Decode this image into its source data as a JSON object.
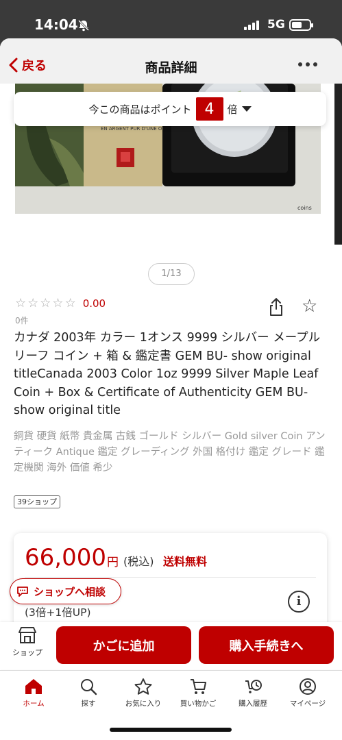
{
  "status_bar": {
    "time": "14:04",
    "network": "5G"
  },
  "navbar": {
    "back_label": "戻る",
    "title": "商品詳細"
  },
  "points_banner": {
    "prefix": "今この商品はポイント",
    "multiplier": "4",
    "suffix": "倍"
  },
  "image": {
    "pager": "1/13",
    "text_block": "EN ARGENT PUR D'UNE ONCE",
    "watermark": "coins"
  },
  "rating": {
    "score": "0.00",
    "stars_filled": 0,
    "review_count": "0件"
  },
  "product": {
    "title": "カナダ 2003年 カラー 1オンス 9999 シルバー メープルリーフ コイン + 箱 & 鑑定書 GEM BU- show original titleCanada 2003 Color 1oz 9999 Silver Maple Leaf Coin + Box & Certificate of Authenticity GEM BU- show original title",
    "tags": "銅貨 硬貨 紙幣 貴金属 古銭 ゴールド シルバー Gold silver Coin アンティーク Antique 鑑定 グレーディング 外国 格付け 鑑定 グレード 鑑定機関 海外 価値 希少",
    "shop_badge": "39ショップ"
  },
  "price": {
    "amount": "66,000",
    "currency": "円",
    "tax_label": "(税込)",
    "shipping": "送料無料",
    "points_up": "(3倍+1倍UP)"
  },
  "consult_button": "ショップへ相談",
  "actions": {
    "shop_label": "ショップ",
    "add_to_cart": "かごに追加",
    "checkout": "購入手続きへ"
  },
  "tabs": [
    {
      "label": "ホーム",
      "icon": "home-icon",
      "active": true
    },
    {
      "label": "探す",
      "icon": "search-icon",
      "active": false
    },
    {
      "label": "お気に入り",
      "icon": "star-icon",
      "active": false
    },
    {
      "label": "買い物かご",
      "icon": "cart-icon",
      "active": false
    },
    {
      "label": "購入履歴",
      "icon": "history-icon",
      "active": false
    },
    {
      "label": "マイページ",
      "icon": "user-icon",
      "active": false
    }
  ],
  "colors": {
    "accent": "#bf0000",
    "muted": "#999999"
  }
}
